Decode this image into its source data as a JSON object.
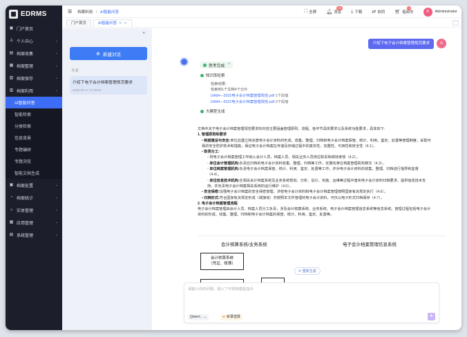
{
  "app": {
    "logo": "EDRMS"
  },
  "sidebar": {
    "items": [
      {
        "icon": "home-icon",
        "glyph": "▣",
        "label": "门户首页",
        "chev": false
      },
      {
        "icon": "user-icon",
        "glyph": "♙",
        "label": "个人中心",
        "chev": true
      },
      {
        "icon": "collect-icon",
        "glyph": "▤",
        "label": "档案收集",
        "chev": true
      },
      {
        "icon": "manage-icon",
        "glyph": "▦",
        "label": "档案整理",
        "chev": true
      },
      {
        "icon": "store-icon",
        "glyph": "▧",
        "label": "档案保存",
        "chev": true
      },
      {
        "icon": "use-icon",
        "glyph": "▥",
        "label": "档案利用",
        "chev": true
      }
    ],
    "subitems": [
      "AI智能问答",
      "智能检索",
      "分类检索",
      "信息背景",
      "专题编研",
      "专题浏览",
      "智能文档生成"
    ],
    "items2": [
      {
        "icon": "dispose-icon",
        "glyph": "▣",
        "label": "档案处置"
      },
      {
        "icon": "stats-icon",
        "glyph": "◔",
        "label": "档案统计"
      },
      {
        "icon": "entity-icon",
        "glyph": "⌂",
        "label": "实体管理"
      },
      {
        "icon": "app-icon",
        "glyph": "▦",
        "label": "应用管理"
      },
      {
        "icon": "system-icon",
        "glyph": "▤",
        "label": "系统管理"
      }
    ]
  },
  "topbar": {
    "crumb1": "档案利用",
    "crumb_sep": "/",
    "crumb2": "AI智能问答",
    "fullscreen": "全屏",
    "messages": "消息",
    "messages_badge": "99",
    "download": "下载",
    "collab": "协同",
    "borrow": "借阅车",
    "borrow_badge": "1",
    "avatar": "A",
    "user": "Administrator"
  },
  "tabs": [
    {
      "label": "门户首页"
    },
    {
      "label": "AI智能问答",
      "refresh": "⟳",
      "close": "✕"
    }
  ],
  "tab_more": "···",
  "chatlist": {
    "new_chat": "新建对话",
    "today": "今天",
    "conv_title": "介绍下电子会计档案管理规范要求",
    "conv_time": "2025-09-17 17:29:52"
  },
  "chat": {
    "question": "介绍下电子会计档案管理规范要求",
    "user_avatar": "A",
    "thinking": "思考完成",
    "step1": "知识库检索",
    "retrieval_label": "检索结果:",
    "retrieval_summary": "检索到1个文档4个分片",
    "doc1_name": "DA94—2022电子会计档案管理规范.pdf",
    "doc1_count": "1个段落",
    "doc2_name": "DA94—2022电子会计档案管理规范.pdf",
    "doc2_count": "3个段落",
    "step2": "大模型生成",
    "answer": {
      "intro": "文档中关于电子会计档案管理规范要求的内容主要涵盖管理原则、流程、各环节具体要求以及系统功能要求，具体如下:",
      "h1": "1. 管理原则和要求",
      "p1_bold": "制度建设与安全:",
      "p1": "单位应建立和完善电子会计资料的形成、收集、整理、归档和电子会计档案保管、统计、利用、鉴定、处置等管理制度，采取可靠的安全防护技术和措施，保证电子会计档案在传递及存储过程中的真实性、完整性、可用性和安全性（4.1）。",
      "p2_bold": "职责分工:",
      "s1": "将电子会计档案管理工作纳入会计人员、档案人员、相关业务人员岗位职责和绩效考核（4.2）。",
      "s2_bold": "单位会计管理机构:",
      "s2": "负责应归档的电子会计资料收集、整理、归档等工作，定期向单位档案管理机构移交（4.3）。",
      "s3_bold": "单位档案管理机构:",
      "s3": "负责电子会计档案保管、统计、利用、鉴定、处置等工作，并对电子会计资料的收集、整理、归档进行指导和监督（4.4）。",
      "s4_bold": "单位信息技术机构:",
      "s4": "在相关会计档案系统及业务系统规划、分析、设计、实施、运维等过程中落实电子会计资料归档要求，提供信息技术支持，并负责电子会计档案相关系统的运行维护（4.5）。",
      "p3_bold": "安全保密:",
      "p3": "加强电子会计档案的安全保密管理，涉密电子会计资料和电子会计档案管理按照国家有关规定执行（4.6）。",
      "p4_bold": "归档形式:",
      "p4": "符合国家有关规定形成（或接收）并按照本文件管理的电子会计资料，可仅以电子形式归档保存（4.7）。",
      "h2": "2. 电子会计档案管理流程",
      "p5": "电子会计档案管理由会计人员、档案人员分工负责，涉及会计核算系统、业务系统、电子会计档案管理信息系统等信息系统。管理过程包括电子会计资料的形成、收集、整理、归档和电子会计档案的保管、统计、利用、鉴定、处置等。"
    },
    "diagram": {
      "left_title": "会计核算系统/业务系统",
      "right_title": "电子会计档案管理信息系统",
      "box1_line1": "会计核算系统",
      "box1_line2": "（凭证、账簿）"
    },
    "regenerate": "重新生成",
    "input_placeholder": "请输入你的问题。输入“/”可调用模型指令",
    "model": "Qwen/...",
    "kb": "目录选择"
  }
}
